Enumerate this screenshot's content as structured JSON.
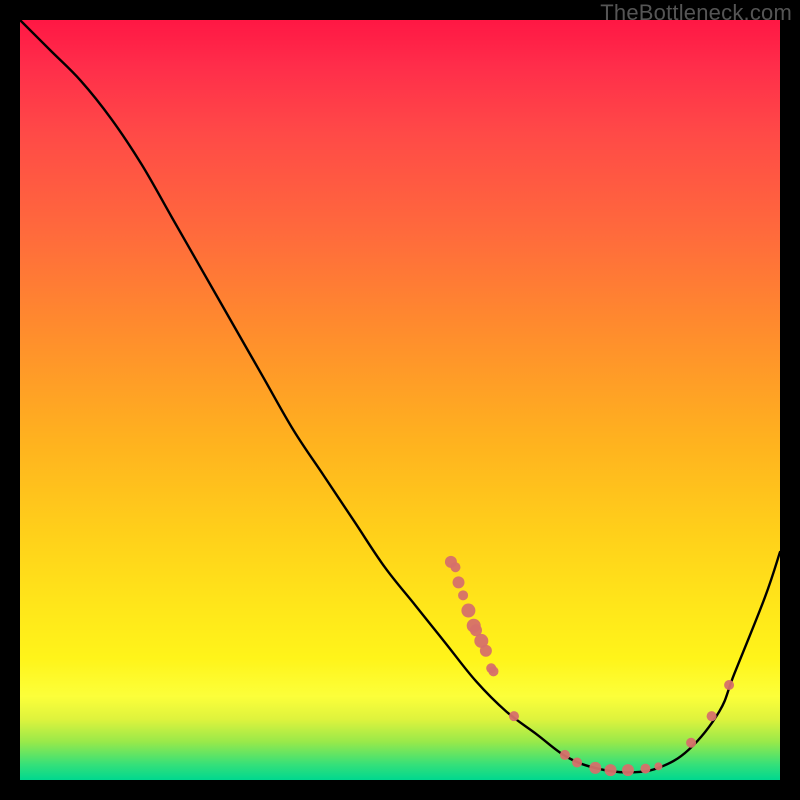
{
  "watermark": "TheBottleneck.com",
  "chart_data": {
    "type": "line",
    "title": "",
    "xlabel": "",
    "ylabel": "",
    "xlim": [
      0,
      100
    ],
    "ylim": [
      0,
      100
    ],
    "grid": false,
    "series": [
      {
        "name": "curve",
        "x": [
          0,
          4,
          8,
          12,
          16,
          20,
          24,
          28,
          32,
          36,
          40,
          44,
          48,
          52,
          56,
          60,
          64,
          68,
          72,
          76,
          80,
          84,
          88,
          92,
          94,
          98,
          100
        ],
        "y": [
          100,
          96,
          92,
          87,
          81,
          74,
          67,
          60,
          53,
          46,
          40,
          34,
          28,
          23,
          18,
          13,
          9,
          6,
          3,
          1.5,
          1,
          1.6,
          4,
          9,
          14,
          24,
          30
        ],
        "stroke": "#000000",
        "stroke_width": 2.4
      }
    ],
    "scatter": [
      {
        "name": "cluster-left",
        "x": 56.7,
        "y": 28.7,
        "r": 6,
        "fill": "#d6706a"
      },
      {
        "name": "cluster-left",
        "x": 57.3,
        "y": 28.0,
        "r": 5,
        "fill": "#d6706a"
      },
      {
        "name": "cluster-left",
        "x": 57.7,
        "y": 26.0,
        "r": 6,
        "fill": "#d6706a"
      },
      {
        "name": "cluster-left",
        "x": 58.3,
        "y": 24.3,
        "r": 5,
        "fill": "#d6706a"
      },
      {
        "name": "cluster-left",
        "x": 59.0,
        "y": 22.3,
        "r": 7,
        "fill": "#d6706a"
      },
      {
        "name": "cluster-left",
        "x": 59.7,
        "y": 20.3,
        "r": 7,
        "fill": "#d6706a"
      },
      {
        "name": "cluster-left",
        "x": 60.0,
        "y": 19.7,
        "r": 6,
        "fill": "#d6706a"
      },
      {
        "name": "cluster-left",
        "x": 60.7,
        "y": 18.3,
        "r": 7,
        "fill": "#d6706a"
      },
      {
        "name": "cluster-left",
        "x": 61.3,
        "y": 17.0,
        "r": 6,
        "fill": "#d6706a"
      },
      {
        "name": "cluster-left",
        "x": 62.0,
        "y": 14.7,
        "r": 5,
        "fill": "#d6706a"
      },
      {
        "name": "cluster-left",
        "x": 62.3,
        "y": 14.3,
        "r": 5,
        "fill": "#d6706a"
      },
      {
        "name": "gap-point",
        "x": 65.0,
        "y": 8.4,
        "r": 5,
        "fill": "#d6706a"
      },
      {
        "name": "cluster-bottom",
        "x": 71.7,
        "y": 3.3,
        "r": 5,
        "fill": "#d6706a"
      },
      {
        "name": "cluster-bottom",
        "x": 73.3,
        "y": 2.3,
        "r": 5,
        "fill": "#d6706a"
      },
      {
        "name": "cluster-bottom",
        "x": 75.7,
        "y": 1.6,
        "r": 6,
        "fill": "#d6706a"
      },
      {
        "name": "cluster-bottom",
        "x": 77.7,
        "y": 1.3,
        "r": 6,
        "fill": "#d6706a"
      },
      {
        "name": "cluster-bottom",
        "x": 80.0,
        "y": 1.3,
        "r": 6,
        "fill": "#d6706a"
      },
      {
        "name": "cluster-bottom",
        "x": 82.3,
        "y": 1.5,
        "r": 5,
        "fill": "#d6706a"
      },
      {
        "name": "cluster-bottom",
        "x": 84.0,
        "y": 1.8,
        "r": 4,
        "fill": "#d6706a"
      },
      {
        "name": "cluster-right",
        "x": 88.3,
        "y": 4.9,
        "r": 5,
        "fill": "#d6706a"
      },
      {
        "name": "cluster-right",
        "x": 91.0,
        "y": 8.4,
        "r": 5,
        "fill": "#d6706a"
      },
      {
        "name": "cluster-right",
        "x": 93.3,
        "y": 12.5,
        "r": 5,
        "fill": "#d6706a"
      }
    ]
  }
}
